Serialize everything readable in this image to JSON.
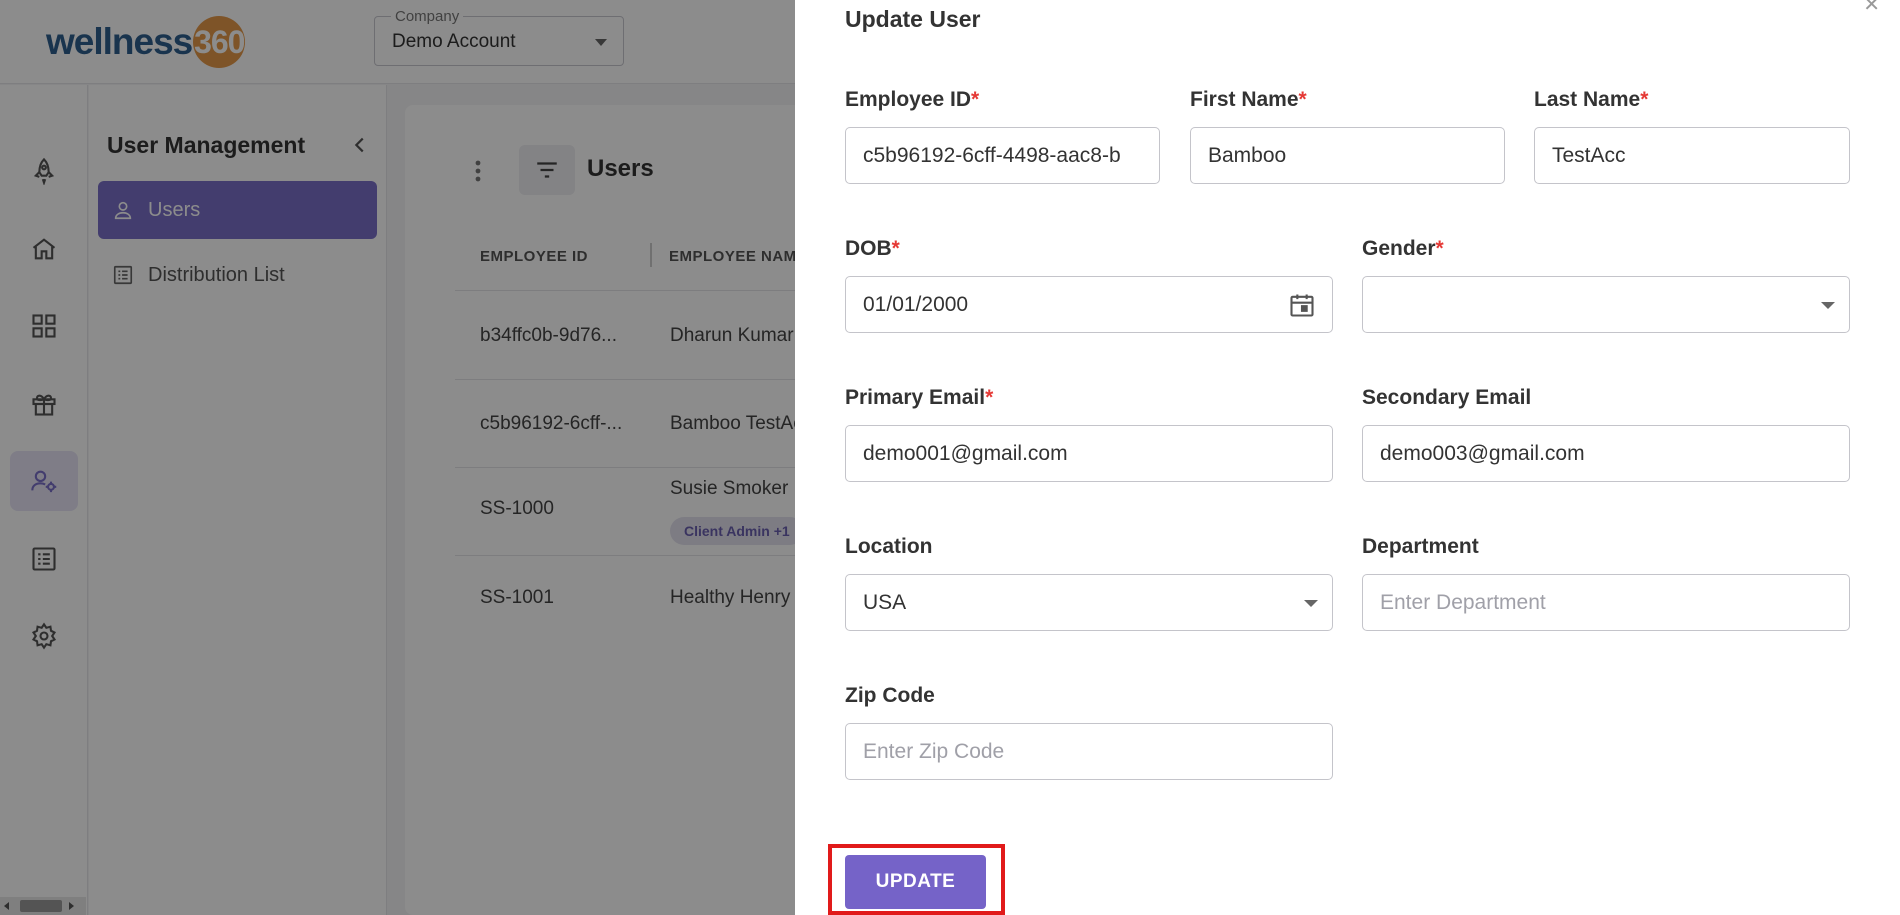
{
  "app": {
    "logo_word": "wellness",
    "logo_number": "360",
    "company": {
      "label": "Company",
      "value": "Demo Account"
    }
  },
  "rail": {
    "icons": [
      "rocket-icon",
      "home-icon",
      "dashboard-icon",
      "gift-icon",
      "user-settings-icon",
      "list-icon",
      "gear-icon"
    ],
    "active_index": 4
  },
  "sidebar": {
    "title": "User Management",
    "items": [
      {
        "label": "Users",
        "icon": "user-icon",
        "active": true
      },
      {
        "label": "Distribution List",
        "icon": "list-icon",
        "active": false
      }
    ]
  },
  "main": {
    "title": "Users",
    "columns": [
      "EMPLOYEE ID",
      "EMPLOYEE NAME"
    ],
    "rows": [
      {
        "id": "b34ffc0b-9d76...",
        "name": "Dharun Kumar"
      },
      {
        "id": "c5b96192-6cff-...",
        "name": "Bamboo TestAcc"
      },
      {
        "id": "SS-1000",
        "name": "Susie Smoker",
        "badge": "Client Admin +1"
      },
      {
        "id": "SS-1001",
        "name": "Healthy Henry"
      }
    ]
  },
  "drawer": {
    "title": "Update User",
    "fields": {
      "employee_id": {
        "label": "Employee ID",
        "required": true,
        "value": "c5b96192-6cff-4498-aac8-b"
      },
      "first_name": {
        "label": "First Name",
        "required": true,
        "value": "Bamboo"
      },
      "last_name": {
        "label": "Last Name",
        "required": true,
        "value": "TestAcc"
      },
      "dob": {
        "label": "DOB",
        "required": true,
        "value": "01/01/2000"
      },
      "gender": {
        "label": "Gender",
        "required": true,
        "value": ""
      },
      "primary_email": {
        "label": "Primary Email",
        "required": true,
        "value": "demo001@gmail.com"
      },
      "secondary_email": {
        "label": "Secondary Email",
        "required": false,
        "value": "demo003@gmail.com"
      },
      "location": {
        "label": "Location",
        "required": false,
        "value": "USA"
      },
      "department": {
        "label": "Department",
        "required": false,
        "value": "",
        "placeholder": "Enter Department"
      },
      "zip_code": {
        "label": "Zip Code",
        "required": false,
        "value": "",
        "placeholder": "Enter Zip Code"
      }
    },
    "update_label": "UPDATE",
    "required_marker": "*"
  },
  "colors": {
    "accent": "#7563c8",
    "highlight": "#e11a1a",
    "required": "#e53935"
  }
}
